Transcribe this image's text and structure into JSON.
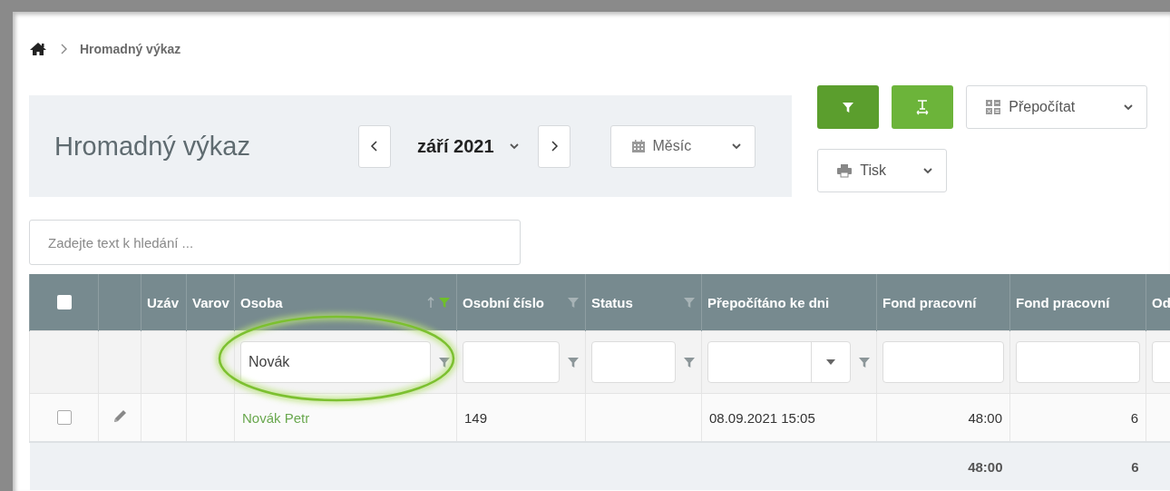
{
  "breadcrumb": {
    "current": "Hromadný výkaz"
  },
  "header": {
    "title": "Hromadný výkaz",
    "period": "září 2021",
    "view": "Měsíc"
  },
  "toolbar": [
    {
      "kind": "filter"
    },
    {
      "kind": "column-width"
    },
    {
      "kind": "recalc",
      "label": "Přepočítat"
    },
    {
      "kind": "print",
      "label": "Tisk"
    }
  ],
  "search": {
    "placeholder": "Zadejte text k hledání ..."
  },
  "table": {
    "select_all": {
      "checked": false
    },
    "columns": [
      {
        "kind": "select"
      },
      {
        "kind": "edit"
      },
      {
        "kind": "text",
        "label": "Uzáv",
        "sorted": false
      },
      {
        "kind": "text",
        "label": "Varov",
        "sorted": false
      },
      {
        "kind": "link",
        "label": "Osoba",
        "sorted": true,
        "filter_active": true
      },
      {
        "kind": "text",
        "label": "Osobní číslo",
        "sorted": false,
        "filter_active": false
      },
      {
        "kind": "text",
        "label": "Status",
        "sorted": false,
        "filter_active": false
      },
      {
        "kind": "text",
        "label": "Přepočítáno ke dni",
        "sorted": false
      },
      {
        "kind": "number",
        "label": "Fond pracovní",
        "sorted": false,
        "total": "48:00"
      },
      {
        "kind": "number",
        "label": "Fond pracovní",
        "sorted": false,
        "total": "6"
      },
      {
        "kind": "text",
        "label": "Od",
        "sorted": false
      }
    ],
    "filters": [
      {
        "kind": "none"
      },
      {
        "kind": "none"
      },
      {
        "kind": "none"
      },
      {
        "kind": "none"
      },
      {
        "kind": "text",
        "value": "Novák"
      },
      {
        "kind": "text"
      },
      {
        "kind": "text"
      },
      {
        "kind": "dropdown"
      },
      {
        "kind": "input"
      },
      {
        "kind": "input"
      },
      {
        "kind": "input"
      }
    ],
    "rows": [
      {
        "checked": false,
        "cells": [
          "",
          "",
          "",
          "",
          "Novák Petr",
          "149",
          "",
          "08.09.2021 15:05",
          "48:00",
          "6",
          ""
        ]
      }
    ]
  },
  "highlight": {
    "kind": "ellipse"
  }
}
